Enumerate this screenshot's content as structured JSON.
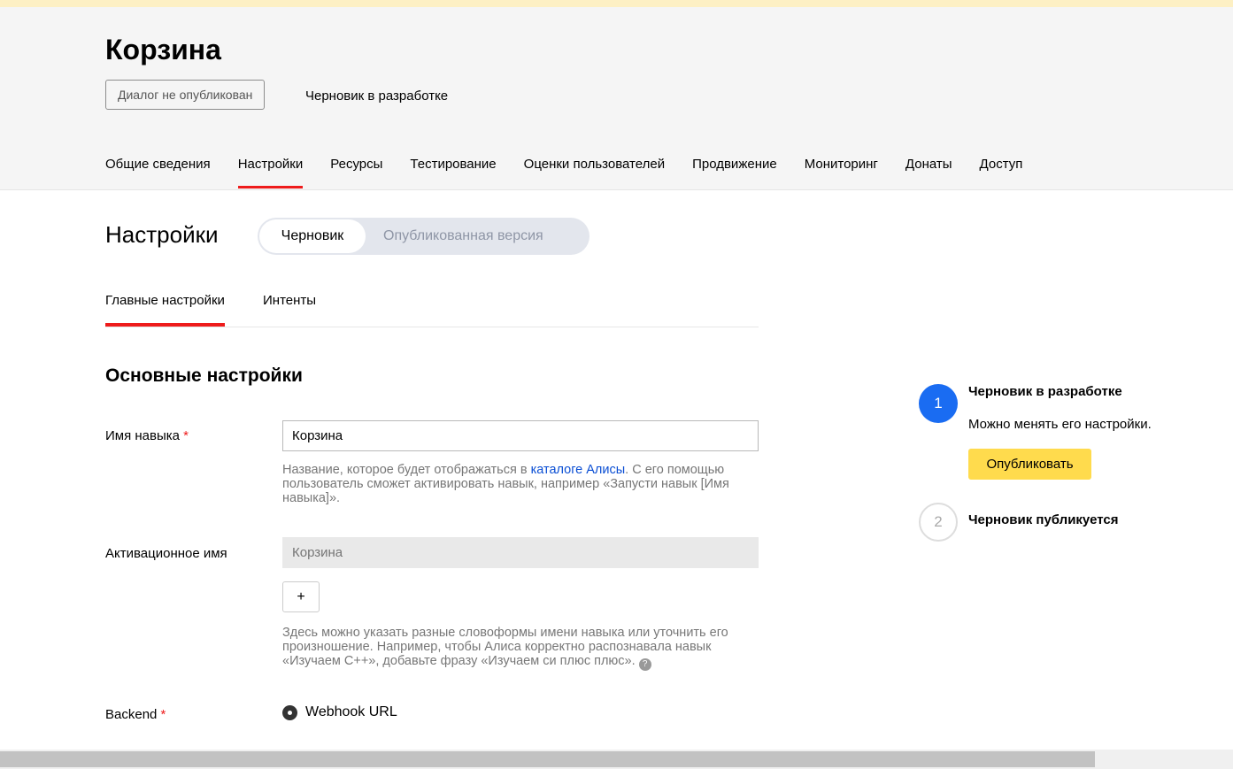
{
  "header": {
    "title": "Корзина",
    "status_badge": "Диалог не опубликован",
    "status_text": "Черновик в разработке",
    "tabs": [
      {
        "label": "Общие сведения",
        "active": false
      },
      {
        "label": "Настройки",
        "active": true
      },
      {
        "label": "Ресурсы",
        "active": false
      },
      {
        "label": "Тестирование",
        "active": false
      },
      {
        "label": "Оценки пользователей",
        "active": false
      },
      {
        "label": "Продвижение",
        "active": false
      },
      {
        "label": "Мониторинг",
        "active": false
      },
      {
        "label": "Донаты",
        "active": false
      },
      {
        "label": "Доступ",
        "active": false
      }
    ]
  },
  "settings": {
    "title": "Настройки",
    "toggle": {
      "active": "Черновик",
      "inactive": "Опубликованная версия"
    },
    "subtabs": [
      {
        "label": "Главные настройки",
        "active": true
      },
      {
        "label": "Интенты",
        "active": false
      }
    ],
    "section_title": "Основные настройки",
    "required_mark": "*",
    "skill_name": {
      "label": "Имя навыка",
      "value": "Корзина",
      "hint_before": "Название, которое будет отображаться в ",
      "hint_link": "каталоге Алисы",
      "hint_after": ". С его помощью пользователь сможет активировать навык, например «Запусти навык [Имя навыка]»."
    },
    "activation_name": {
      "label": "Активационное имя",
      "placeholder": "Корзина",
      "add_button": "+",
      "hint": "Здесь можно указать разные словоформы имени навыка или уточнить его произношение. Например, чтобы Алиса корректно распознавала навык «Изучаем С++», добавьте фразу «Изучаем си плюс плюс».",
      "help_glyph": "?"
    },
    "backend": {
      "label": "Backend",
      "option": "Webhook URL"
    }
  },
  "sidebar": {
    "steps": [
      {
        "number": "1",
        "title": "Черновик в разработке",
        "description": "Можно менять его настройки.",
        "button": "Опубликовать"
      },
      {
        "number": "2",
        "title": "Черновик публикуется"
      }
    ]
  },
  "colors": {
    "accent_red": "#ee1b1b",
    "primary_blue": "#1a6cf2",
    "publish_yellow": "#ffdb4d",
    "link_blue": "#0a4ed4"
  },
  "scrollbar": {
    "position_fraction": 0.0,
    "visible_fraction": 0.89
  }
}
